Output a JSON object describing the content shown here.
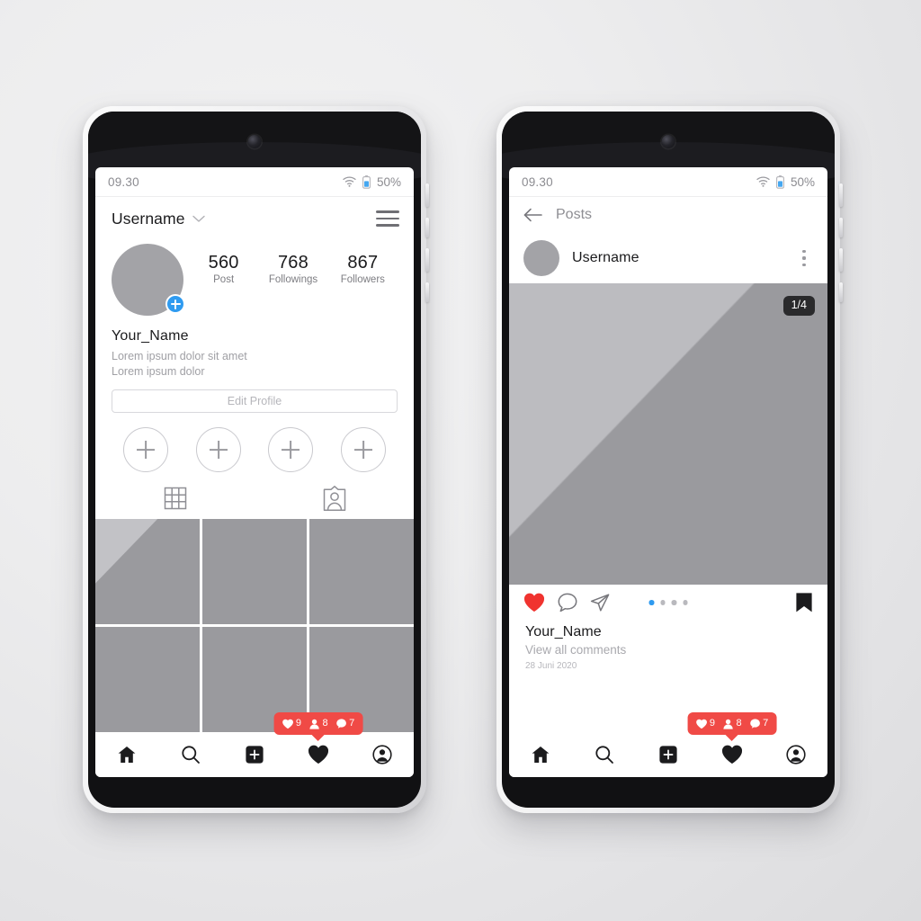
{
  "status_bar": {
    "time": "09.30",
    "battery_pct": "50%",
    "wifi_icon": "wifi-icon",
    "battery_icon": "battery-icon"
  },
  "phone_left": {
    "screen_name": "profile-screen",
    "topbar": {
      "username": "Username",
      "chevron_icon": "chevron-down-icon",
      "menu_icon": "hamburger-menu-icon"
    },
    "avatar": {
      "add_icon": "plus-circle-icon"
    },
    "stats": [
      {
        "value": "560",
        "label": "Post"
      },
      {
        "value": "768",
        "label": "Followings"
      },
      {
        "value": "867",
        "label": "Followers"
      }
    ],
    "bio": {
      "name": "Your_Name",
      "line1": "Lorem ipsum dolor sit amet",
      "line2": "Lorem ipsum dolor"
    },
    "edit_profile_label": "Edit Profile",
    "highlights": [
      {
        "icon": "plus-icon"
      },
      {
        "icon": "plus-icon"
      },
      {
        "icon": "plus-icon"
      },
      {
        "icon": "plus-icon"
      }
    ],
    "tabs": [
      {
        "name": "grid-tab",
        "icon": "grid-icon"
      },
      {
        "name": "tagged-tab",
        "icon": "tagged-person-icon"
      }
    ],
    "grid_tiles": [
      {
        "highlight": true
      },
      {
        "highlight": false
      },
      {
        "highlight": false
      },
      {
        "highlight": false
      },
      {
        "highlight": false
      },
      {
        "highlight": false
      }
    ]
  },
  "phone_right": {
    "screen_name": "post-detail-screen",
    "topbar": {
      "back_icon": "arrow-left-icon",
      "title": "Posts"
    },
    "post_header": {
      "username": "Username",
      "menu_icon": "kebab-menu-icon"
    },
    "post_image": {
      "page_counter": "1/4"
    },
    "actions": {
      "like_icon": "heart-filled-icon",
      "comment_icon": "comment-bubble-icon",
      "share_icon": "send-arrow-icon",
      "save_icon": "bookmark-filled-icon"
    },
    "carousel": {
      "total": 4,
      "active_index": 0
    },
    "caption": {
      "name": "Your_Name",
      "view_comments": "View all comments",
      "date": "28 Juni 2020"
    }
  },
  "notifications": {
    "items": [
      {
        "icon": "heart-icon",
        "count": "9"
      },
      {
        "icon": "person-icon",
        "count": "8"
      },
      {
        "icon": "comment-icon",
        "count": "7"
      }
    ]
  },
  "bottom_nav": [
    {
      "name": "nav-home",
      "icon": "home-icon"
    },
    {
      "name": "nav-search",
      "icon": "search-icon"
    },
    {
      "name": "nav-add",
      "icon": "plus-square-icon"
    },
    {
      "name": "nav-activity",
      "icon": "heart-filled-icon"
    },
    {
      "name": "nav-profile",
      "icon": "profile-circle-icon"
    }
  ],
  "colors": {
    "accent_blue": "#2f9bf0",
    "notification_red": "#f04a46",
    "placeholder_gray": "#9a9a9e",
    "text_dark": "#1b1b1d"
  }
}
